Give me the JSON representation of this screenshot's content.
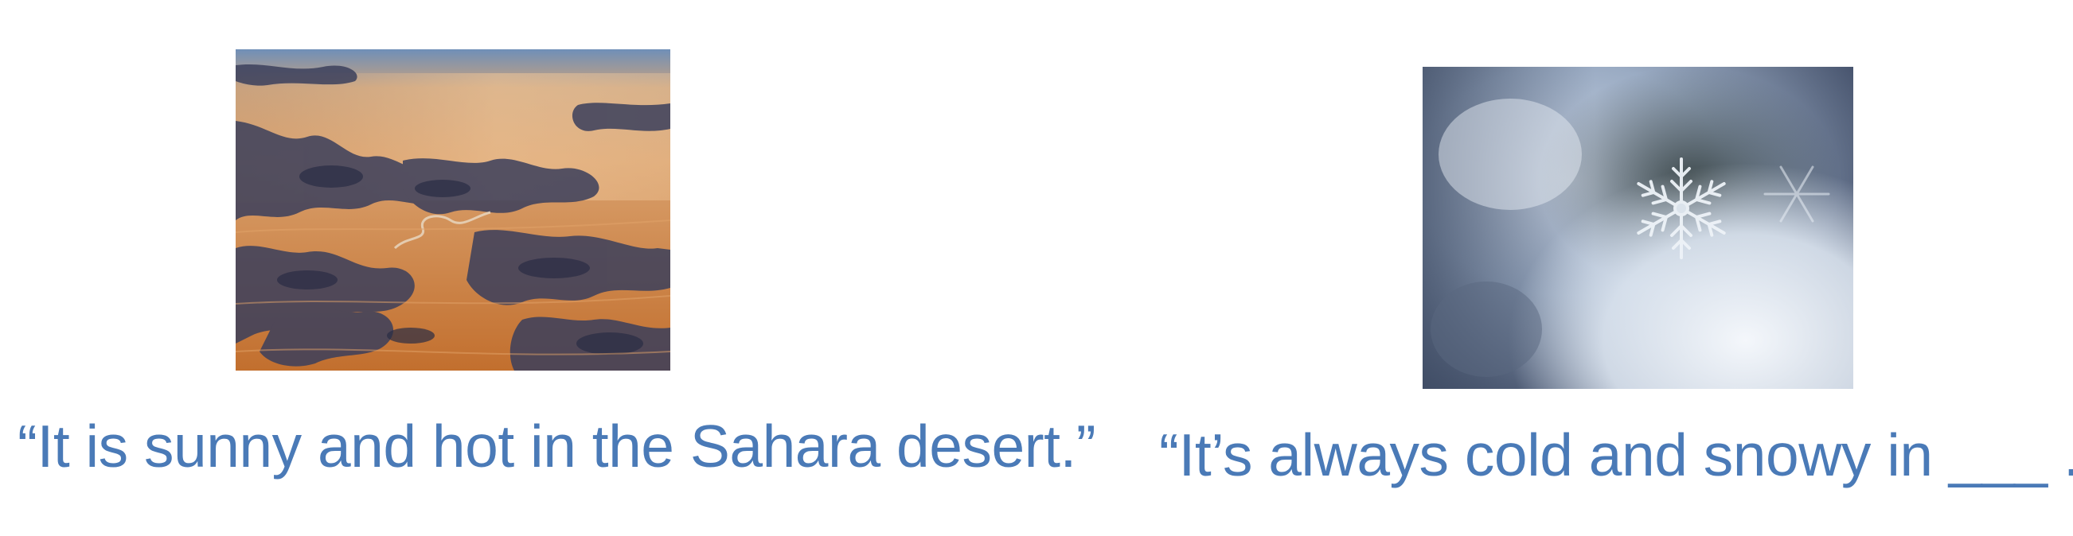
{
  "slide": {
    "left": {
      "image_subject": "aerial-desert-photo",
      "caption": "“It is sunny and hot in the Sahara desert.”"
    },
    "right": {
      "image_subject": "snowflake-photo",
      "caption": "“It’s always cold and snowy in ___ .”"
    },
    "caption_color": "#4a7ab7"
  }
}
